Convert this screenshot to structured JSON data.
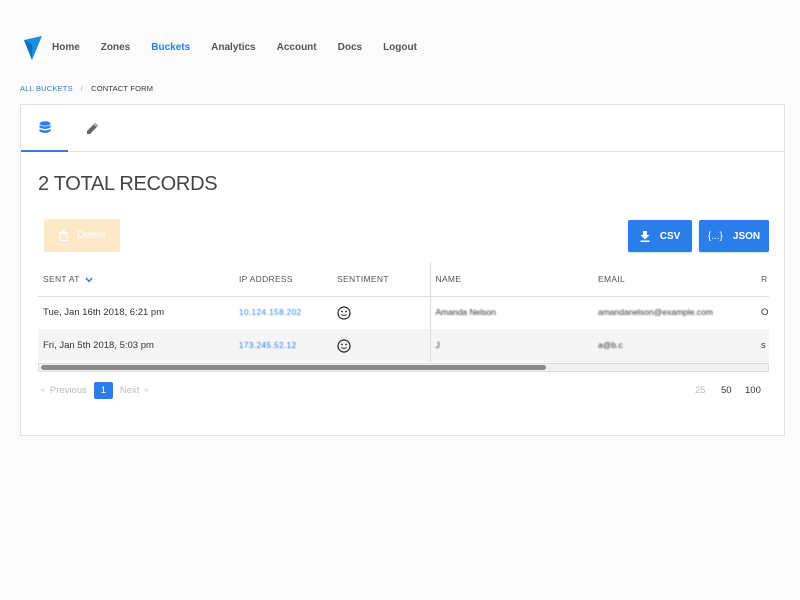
{
  "nav": {
    "links": [
      "Home",
      "Zones",
      "Buckets",
      "Analytics",
      "Account",
      "Docs",
      "Logout"
    ],
    "active_index": 2,
    "accent_color": "#2b7de9"
  },
  "breadcrumb": {
    "parent": "ALL BUCKETS",
    "separator": "/",
    "current": "CONTACT FORM"
  },
  "tabs": [
    {
      "icon": "database-icon",
      "active": true
    },
    {
      "icon": "pencil-icon",
      "active": false
    }
  ],
  "records": {
    "total_label": "2 TOTAL RECORDS"
  },
  "actions": {
    "delete_label": "Delete",
    "csv_label": "CSV",
    "json_label": "JSON",
    "json_icon_text": "{...}"
  },
  "table": {
    "columns": [
      "SENT AT",
      "IP ADDRESS",
      "SENTIMENT",
      "NAME",
      "EMAIL",
      "R"
    ],
    "sort_column": "SENT AT",
    "rows": [
      {
        "sent_at": "Tue, Jan 16th 2018, 6:21 pm",
        "ip": "10.124.158.202",
        "sentiment": "neutral-face-icon",
        "name": "Amanda Nelson",
        "email": "amandanelson@example.com",
        "extra": "O"
      },
      {
        "sent_at": "Fri, Jan 5th 2018, 5:03 pm",
        "ip": "173.245.52.12",
        "sentiment": "neutral-face-icon",
        "name": "J",
        "email": "a@b.c",
        "extra": "s"
      }
    ]
  },
  "pagination": {
    "previous_label": "Previous",
    "next_label": "Next",
    "current_page": "1",
    "per_page_options": [
      "25",
      "50",
      "100"
    ],
    "per_page_selected": "25"
  }
}
